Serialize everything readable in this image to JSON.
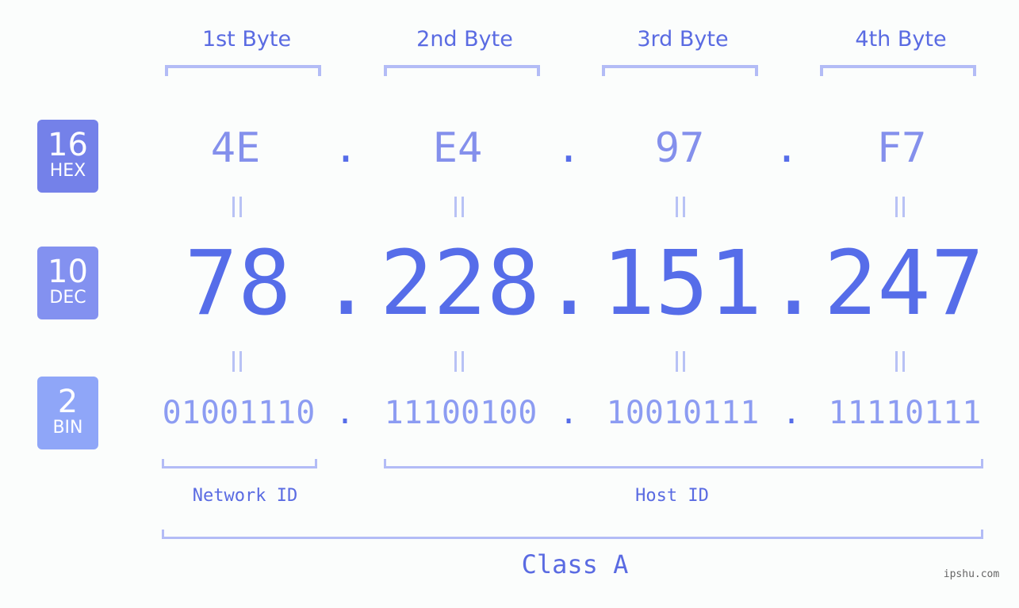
{
  "colors": {
    "hex_badge": "#7481e9",
    "dec_badge": "#8391f0",
    "bin_badge": "#8fa6f8",
    "accent": "#566de9",
    "label": "#5a6be2",
    "bracket": "#b3bcf6"
  },
  "badges": [
    {
      "number": "16",
      "label": "HEX"
    },
    {
      "number": "10",
      "label": "DEC"
    },
    {
      "number": "2",
      "label": "BIN"
    }
  ],
  "byte_labels": [
    "1st Byte",
    "2nd Byte",
    "3rd Byte",
    "4th Byte"
  ],
  "hex": [
    "4E",
    "E4",
    "97",
    "F7"
  ],
  "dec": [
    "78",
    "228",
    "151",
    "247"
  ],
  "bin": [
    "01001110",
    "11100100",
    "10010111",
    "11110111"
  ],
  "separator": ".",
  "network_id_label": "Network ID",
  "host_id_label": "Host ID",
  "class_label": "Class A",
  "watermark": "ipshu.com"
}
